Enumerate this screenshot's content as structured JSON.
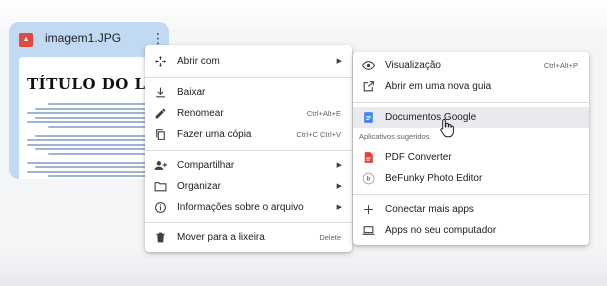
{
  "file": {
    "name": "imagem1.JPG",
    "icon": "image-file-icon",
    "thumbnail_title": "TÍTULO DO LIVRO"
  },
  "context_menu": {
    "items": [
      {
        "label": "Abrir com",
        "icon": "open-with-icon",
        "has_submenu": true
      },
      {
        "label": "Baixar",
        "icon": "download-icon"
      },
      {
        "label": "Renomear",
        "icon": "rename-icon",
        "shortcut": "Ctrl+Alt+E"
      },
      {
        "label": "Fazer uma cópia",
        "icon": "copy-icon",
        "shortcut": "Ctrl+C Ctrl+V"
      },
      {
        "label": "Compartilhar",
        "icon": "share-icon",
        "has_submenu": true
      },
      {
        "label": "Organizar",
        "icon": "folder-icon",
        "has_submenu": true
      },
      {
        "label": "Informações sobre o arquivo",
        "icon": "info-icon",
        "has_submenu": true
      },
      {
        "label": "Mover para a lixeira",
        "icon": "trash-icon",
        "shortcut": "Delete"
      }
    ]
  },
  "open_with_submenu": {
    "items": [
      {
        "label": "Visualização",
        "icon": "eye-icon",
        "shortcut": "Ctrl+Alt+P"
      },
      {
        "label": "Abrir em uma nova guia",
        "icon": "open-new-tab-icon"
      },
      {
        "label": "Documentos Google",
        "icon": "google-docs-icon",
        "highlighted": true
      }
    ],
    "suggested_heading": "Aplicativos sugeridos",
    "suggested_apps": [
      {
        "label": "PDF Converter",
        "icon": "pdf-converter-icon"
      },
      {
        "label": "BeFunky Photo Editor",
        "icon": "befunky-icon"
      }
    ],
    "footer_items": [
      {
        "label": "Conectar mais apps",
        "icon": "plus-icon"
      },
      {
        "label": "Apps no seu computador",
        "icon": "laptop-icon"
      }
    ]
  },
  "colors": {
    "card_background": "#c2d9f3",
    "highlight": "#e8eaed",
    "docs_blue": "#4285f4",
    "pdf_red": "#e94235"
  }
}
